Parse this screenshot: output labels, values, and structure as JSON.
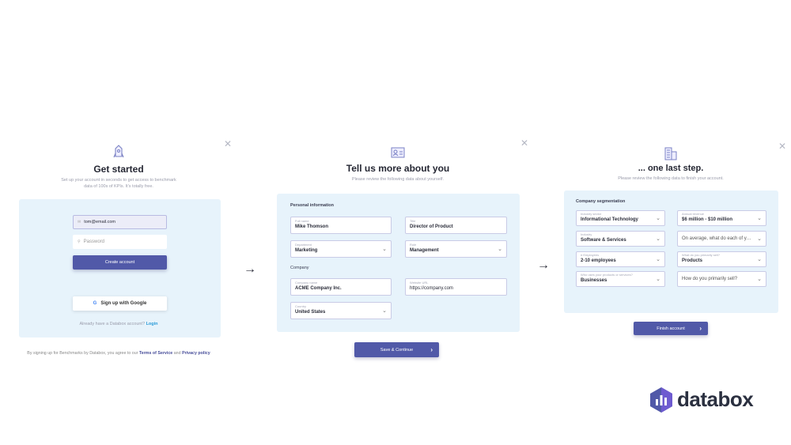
{
  "step1": {
    "title": "Get started",
    "subtitle_line1": "Set up your account in seconds to get access to benchmark",
    "subtitle_line2": "data of 100s of KPIs. It's totally free.",
    "email_value": "tom@email.com",
    "password_placeholder": "Password",
    "create_label": "Create account",
    "google_label": "Sign up with Google",
    "login_prompt": "Already have a Databox account?",
    "login_link": "Login",
    "footer_prefix": "By signing up for Benchmarks by Databox, you agree to our",
    "terms_link": "Terms of Service",
    "footer_and": "and",
    "privacy_link": "Privacy policy"
  },
  "step2": {
    "title": "Tell us more about you",
    "subtitle": "Please review the following data about yourself.",
    "personal_label": "Personal information",
    "company_label": "Company",
    "fields": [
      {
        "caption": "Full name",
        "value": "Mike Thomson"
      },
      {
        "caption": "Title",
        "value": "Director of Product"
      },
      {
        "caption": "Department",
        "value": "Marketing"
      },
      {
        "caption": "Role",
        "value": "Management"
      },
      {
        "caption": "Company name",
        "value": "ACME Company Inc."
      },
      {
        "caption": "Website URL",
        "value": "https://company.com"
      },
      {
        "caption": "Country",
        "value": "United States"
      }
    ],
    "save_label": "Save & Continue"
  },
  "step3": {
    "title": "... one last step.",
    "subtitle": "Please review the following data to finish your account.",
    "segment_label": "Company segmentation",
    "fields": [
      {
        "caption": "Industry sector",
        "value": "Informational Technology"
      },
      {
        "caption": "Annual revenue",
        "value": "$6 million - $10 million"
      },
      {
        "caption": "Industry",
        "value": "Software & Services"
      },
      {
        "caption": "",
        "placeholder": "On average, what do each of your customers pay?"
      },
      {
        "caption": "# Employees",
        "value": "2-10 employees"
      },
      {
        "caption": "What do you primarily sell?",
        "value": "Products"
      },
      {
        "caption": "Who uses your products or services?",
        "value": "Businesses"
      },
      {
        "caption": "",
        "placeholder": "How do you primarily sell?"
      }
    ],
    "finish_label": "Finish account"
  },
  "brand": {
    "name": "databox",
    "accent": "#5159a8"
  }
}
